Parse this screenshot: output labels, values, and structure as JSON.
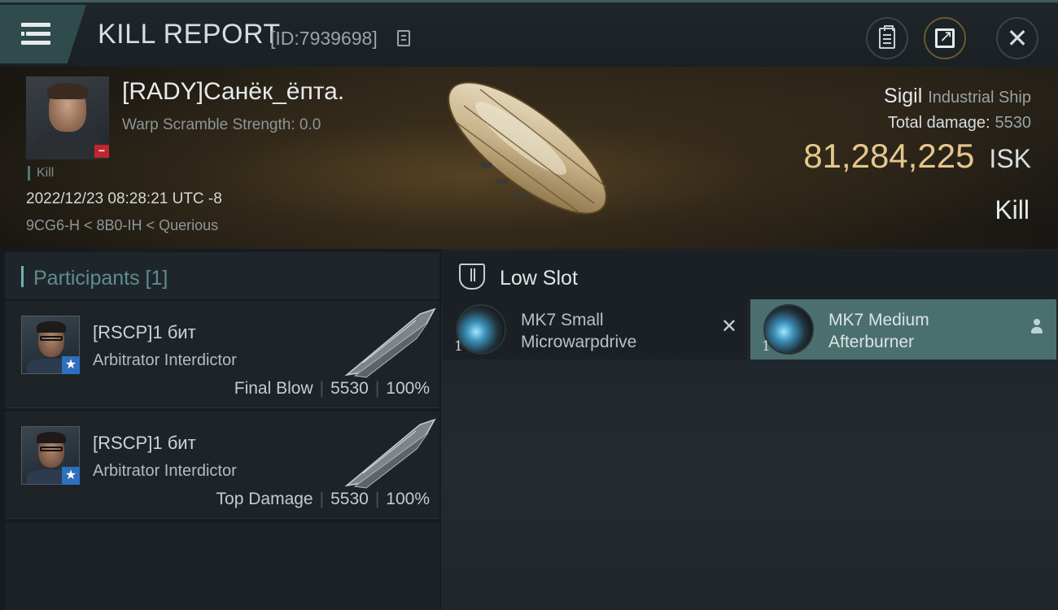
{
  "header": {
    "title": "KILL REPORT",
    "report_id": "[ID:7939698]",
    "buttons": {
      "clipboard": "clipboard-icon",
      "share": "share-icon",
      "close": "close-icon"
    }
  },
  "victim": {
    "name": "[RADY]Санёк_ёпта.",
    "warp_scramble": "Warp Scramble Strength: 0.0",
    "tag": "Kill",
    "datetime": "2022/12/23 08:28:21 UTC -8",
    "location": "9CG6-H < 8B0-IH < Querious",
    "ship_name": "Sigil",
    "ship_class": "Industrial Ship",
    "total_damage_label": "Total damage:",
    "total_damage": "5530",
    "isk_value": "81,284,225",
    "isk_unit": "ISK",
    "result": "Kill"
  },
  "participants": {
    "heading": "Participants [1]",
    "rows": [
      {
        "name": "[RSCP]1 бит",
        "ship": "Arbitrator Interdictor",
        "role": "Final Blow",
        "damage": "5530",
        "percent": "100%"
      },
      {
        "name": "[RSCP]1 бит",
        "ship": "Arbitrator Interdictor",
        "role": "Top Damage",
        "damage": "5530",
        "percent": "100%"
      }
    ]
  },
  "slots": {
    "title": "Low Slot",
    "modules": [
      {
        "line1": "MK7 Small",
        "line2": "Microwarpdrive",
        "qty": "1",
        "state": "destroyed"
      },
      {
        "line1": "MK7 Medium",
        "line2": "Afterburner",
        "qty": "1",
        "state": "dropped"
      }
    ]
  },
  "colors": {
    "accent_teal": "#4b6f6e",
    "isk_gold": "#e4c78e",
    "badge_red": "#c0262b",
    "badge_blue": "#2e6fc0"
  }
}
